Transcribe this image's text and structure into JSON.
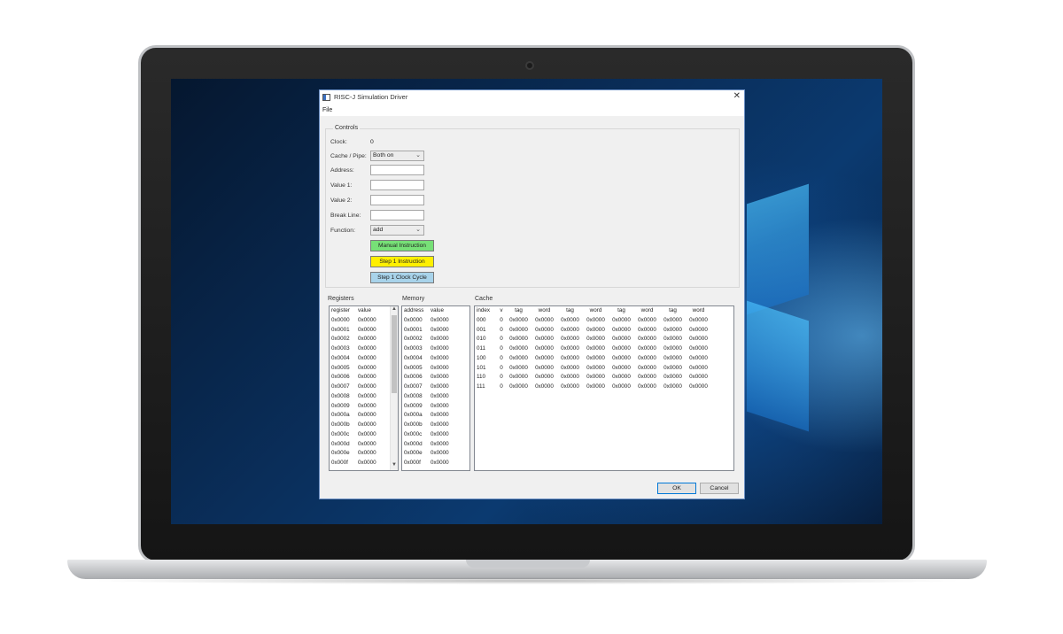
{
  "window": {
    "title": "RISC-J Simulation Driver",
    "close_glyph": "✕"
  },
  "menu": {
    "file": "File"
  },
  "controls": {
    "group_label": "Controls",
    "clock_label": "Clock:",
    "clock_value": "0",
    "cache_pipe_label": "Cache / Pipe:",
    "cache_pipe_value": "Both on",
    "address_label": "Address:",
    "value1_label": "Value 1:",
    "value2_label": "Value 2:",
    "break_line_label": "Break Line:",
    "function_label": "Function:",
    "function_value": "add",
    "manual_instruction": "Manual Instruction",
    "step_instruction": "Step 1 Instruction",
    "step_clock": "Step 1 Clock Cycle"
  },
  "registers": {
    "label": "Registers",
    "headers": [
      "register",
      "value"
    ],
    "rows": [
      [
        "0x0000",
        "0x0000"
      ],
      [
        "0x0001",
        "0x0000"
      ],
      [
        "0x0002",
        "0x0000"
      ],
      [
        "0x0003",
        "0x0000"
      ],
      [
        "0x0004",
        "0x0000"
      ],
      [
        "0x0005",
        "0x0000"
      ],
      [
        "0x0006",
        "0x0000"
      ],
      [
        "0x0007",
        "0x0000"
      ],
      [
        "0x0008",
        "0x0000"
      ],
      [
        "0x0009",
        "0x0000"
      ],
      [
        "0x000a",
        "0x0000"
      ],
      [
        "0x000b",
        "0x0000"
      ],
      [
        "0x000c",
        "0x0000"
      ],
      [
        "0x000d",
        "0x0000"
      ],
      [
        "0x000e",
        "0x0000"
      ],
      [
        "0x000f",
        "0x0000"
      ]
    ]
  },
  "memory": {
    "label": "Memory",
    "headers": [
      "address",
      "value"
    ],
    "rows": [
      [
        "0x0000",
        "0x0000"
      ],
      [
        "0x0001",
        "0x0000"
      ],
      [
        "0x0002",
        "0x0000"
      ],
      [
        "0x0003",
        "0x0000"
      ],
      [
        "0x0004",
        "0x0000"
      ],
      [
        "0x0005",
        "0x0000"
      ],
      [
        "0x0006",
        "0x0000"
      ],
      [
        "0x0007",
        "0x0000"
      ],
      [
        "0x0008",
        "0x0000"
      ],
      [
        "0x0009",
        "0x0000"
      ],
      [
        "0x000a",
        "0x0000"
      ],
      [
        "0x000b",
        "0x0000"
      ],
      [
        "0x000c",
        "0x0000"
      ],
      [
        "0x000d",
        "0x0000"
      ],
      [
        "0x000e",
        "0x0000"
      ],
      [
        "0x000f",
        "0x0000"
      ]
    ]
  },
  "cache": {
    "label": "Cache",
    "headers": [
      "index",
      "v",
      "tag",
      "word",
      "tag",
      "word",
      "tag",
      "word",
      "tag",
      "word"
    ],
    "rows": [
      [
        "000",
        "0",
        "0x0000",
        "0x0000",
        "0x0000",
        "0x0000",
        "0x0000",
        "0x0000",
        "0x0000",
        "0x0000"
      ],
      [
        "001",
        "0",
        "0x0000",
        "0x0000",
        "0x0000",
        "0x0000",
        "0x0000",
        "0x0000",
        "0x0000",
        "0x0000"
      ],
      [
        "010",
        "0",
        "0x0000",
        "0x0000",
        "0x0000",
        "0x0000",
        "0x0000",
        "0x0000",
        "0x0000",
        "0x0000"
      ],
      [
        "011",
        "0",
        "0x0000",
        "0x0000",
        "0x0000",
        "0x0000",
        "0x0000",
        "0x0000",
        "0x0000",
        "0x0000"
      ],
      [
        "100",
        "0",
        "0x0000",
        "0x0000",
        "0x0000",
        "0x0000",
        "0x0000",
        "0x0000",
        "0x0000",
        "0x0000"
      ],
      [
        "101",
        "0",
        "0x0000",
        "0x0000",
        "0x0000",
        "0x0000",
        "0x0000",
        "0x0000",
        "0x0000",
        "0x0000"
      ],
      [
        "110",
        "0",
        "0x0000",
        "0x0000",
        "0x0000",
        "0x0000",
        "0x0000",
        "0x0000",
        "0x0000",
        "0x0000"
      ],
      [
        "111",
        "0",
        "0x0000",
        "0x0000",
        "0x0000",
        "0x0000",
        "0x0000",
        "0x0000",
        "0x0000",
        "0x0000"
      ]
    ]
  },
  "footer": {
    "ok": "OK",
    "cancel": "Cancel"
  },
  "colors": {
    "manual_button": "#77e077",
    "step_instruction_button": "#fff000",
    "step_clock_button": "#a8d3ea"
  }
}
